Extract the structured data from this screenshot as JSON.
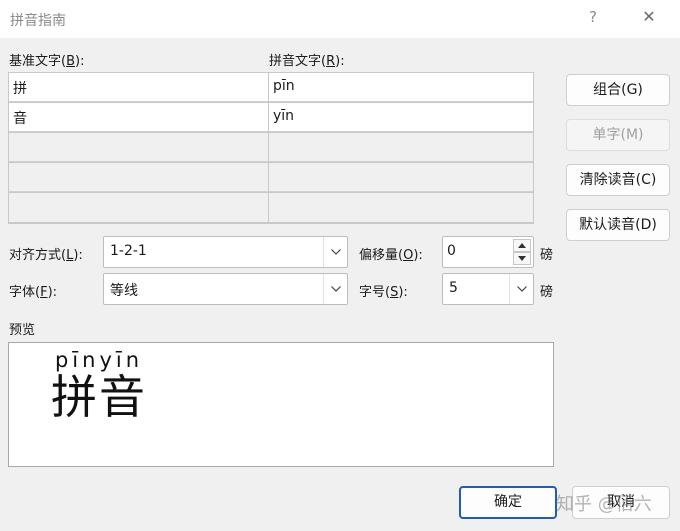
{
  "window": {
    "title": "拼音指南",
    "help_glyph": "?",
    "close_glyph": "✕"
  },
  "labels": {
    "base_text_pre": "基准文字(",
    "base_text_key": "B",
    "base_text_post": "):",
    "pinyin_text_pre": "拼音文字(",
    "pinyin_text_key": "R",
    "pinyin_text_post": "):",
    "alignment_pre": "对齐方式(",
    "alignment_key": "L",
    "alignment_post": "):",
    "offset_pre": "偏移量(",
    "offset_key": "O",
    "offset_post": "):",
    "font_pre": "字体(",
    "font_key": "F",
    "font_post": "):",
    "size_pre": "字号(",
    "size_key": "S",
    "size_post": "):",
    "unit": "磅",
    "preview": "预览"
  },
  "grid": {
    "rows": [
      {
        "base": "拼",
        "pinyin": "pīn"
      },
      {
        "base": "音",
        "pinyin": "yīn"
      },
      {
        "base": "",
        "pinyin": ""
      },
      {
        "base": "",
        "pinyin": ""
      },
      {
        "base": "",
        "pinyin": ""
      }
    ]
  },
  "buttons": {
    "group": "组合(G)",
    "single": "单字(M)",
    "clear": "清除读音(C)",
    "default": "默认读音(D)",
    "ok": "确定",
    "cancel": "取消"
  },
  "fields": {
    "alignment": "1-2-1",
    "offset": "0",
    "font": "等线",
    "size": "5"
  },
  "preview": {
    "ruby": "pīnyīn",
    "base": "拼音"
  },
  "watermark": "知乎 @佰六"
}
